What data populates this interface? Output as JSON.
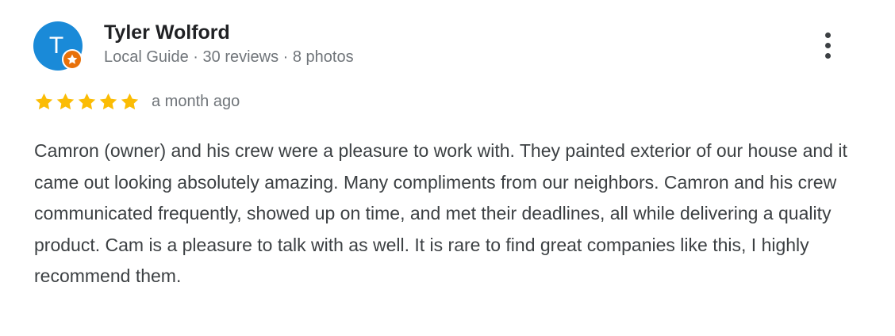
{
  "review": {
    "author": {
      "initial": "T",
      "name": "Tyler Wolford",
      "meta": "Local Guide · 30 reviews · 8 photos",
      "badge_icon": "local-guide-star-icon"
    },
    "rating": 5,
    "rating_max": 5,
    "time_ago": "a month ago",
    "text": "Camron (owner) and his crew were a pleasure to work with. They painted exterior of our house and it came out looking absolutely amazing. Many compliments from our neighbors. Camron and his crew communicated frequently, showed up on time, and met their deadlines, all while delivering a quality product. Cam is a pleasure to talk with as well. It is rare to find great companies like this, I highly recommend them.",
    "menu_icon": "more-vert-icon"
  },
  "colors": {
    "avatar_bg": "#1a8ad8",
    "badge_bg": "#e8710a",
    "star": "#fbbc04",
    "name": "#202124",
    "meta": "#70757a",
    "body": "#3c4043"
  }
}
